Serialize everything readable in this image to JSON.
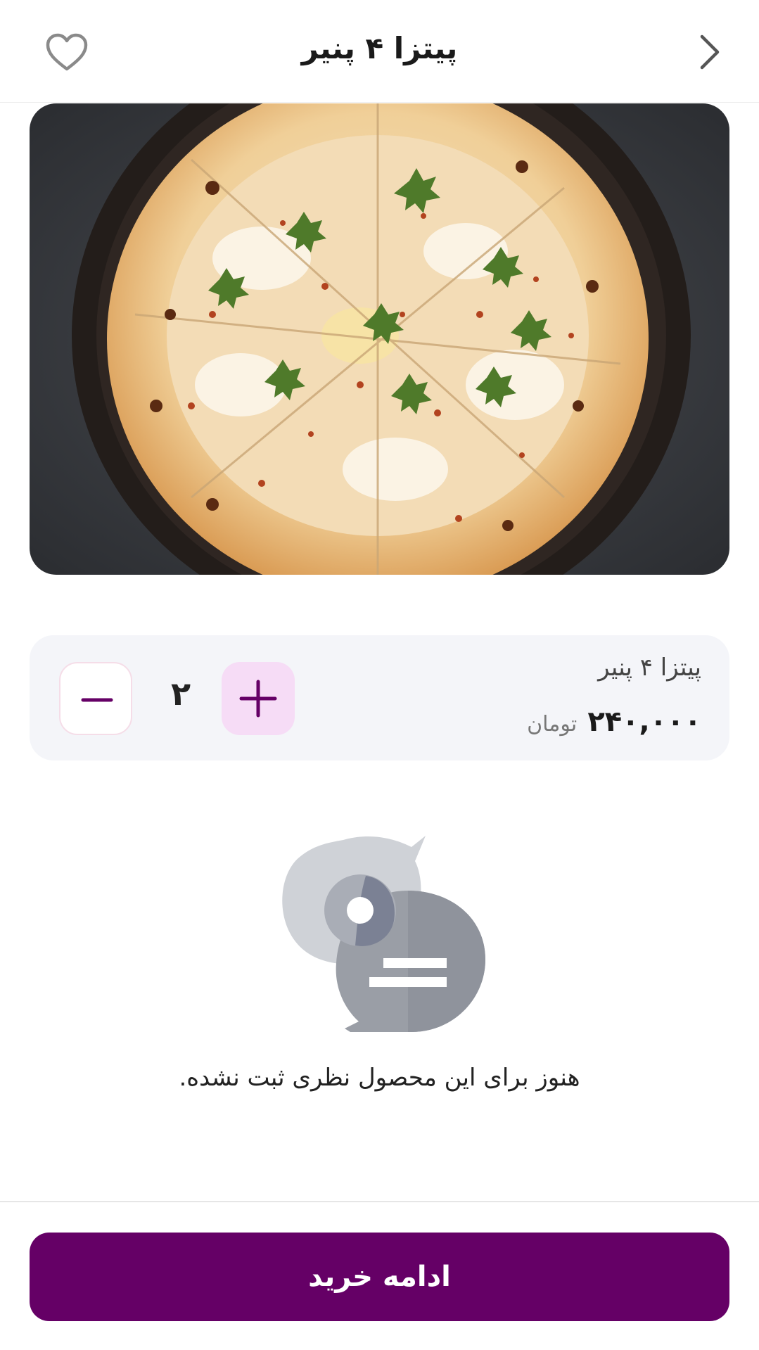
{
  "header": {
    "title": "پیتزا ۴ پنیر",
    "back_icon": "chevron-right-icon",
    "favorite_icon": "heart-outline-icon"
  },
  "product": {
    "image_alt": "pizza-photo",
    "name": "پیتزا ۴ پنیر",
    "price": "۲۴۰,۰۰۰",
    "currency": "تومان",
    "quantity": "۲"
  },
  "reviews": {
    "empty_icon": "chat-bubbles-icon",
    "empty_message": "هنوز برای این محصول نظری ثبت نشده."
  },
  "footer": {
    "cta_label": "ادامه خرید"
  },
  "colors": {
    "primary": "#650066",
    "plus_button_bg": "#f6dcf6",
    "card_bg": "#f4f5f9"
  }
}
